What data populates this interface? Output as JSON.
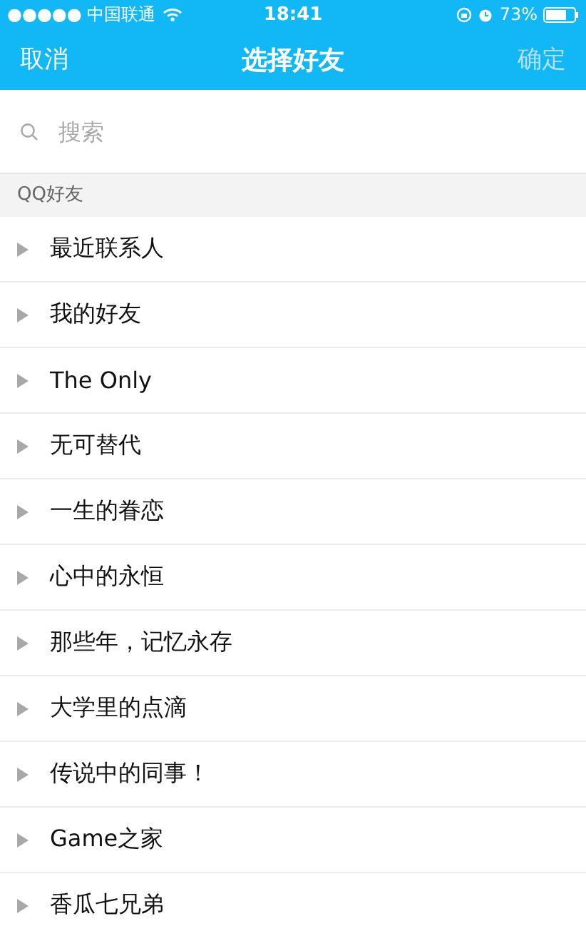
{
  "status_bar": {
    "carrier": "●●●●● 中国联通",
    "time": "18:41",
    "battery": "73%"
  },
  "nav": {
    "cancel": "取消",
    "title": "选择好友",
    "confirm": {
      "label": "确定",
      "disabled": true
    }
  },
  "search": {
    "placeholder": "搜索"
  },
  "section": {
    "title": "QQ好友"
  },
  "groups": [
    {
      "label": "最近联系人",
      "expanded": false
    },
    {
      "label": "我的好友",
      "expanded": false
    },
    {
      "label": "The Only",
      "expanded": false
    },
    {
      "label": "无可替代",
      "expanded": false
    },
    {
      "label": "一生的眷恋",
      "expanded": false
    },
    {
      "label": "心中的永恒",
      "expanded": false
    },
    {
      "label": "那些年，记忆永存",
      "expanded": false
    },
    {
      "label": "大学里的点滴",
      "expanded": false
    },
    {
      "label": "传说中的同事！",
      "expanded": false
    },
    {
      "label": "Game之家",
      "expanded": false
    },
    {
      "label": "香瓜七兄弟",
      "expanded": false
    }
  ]
}
